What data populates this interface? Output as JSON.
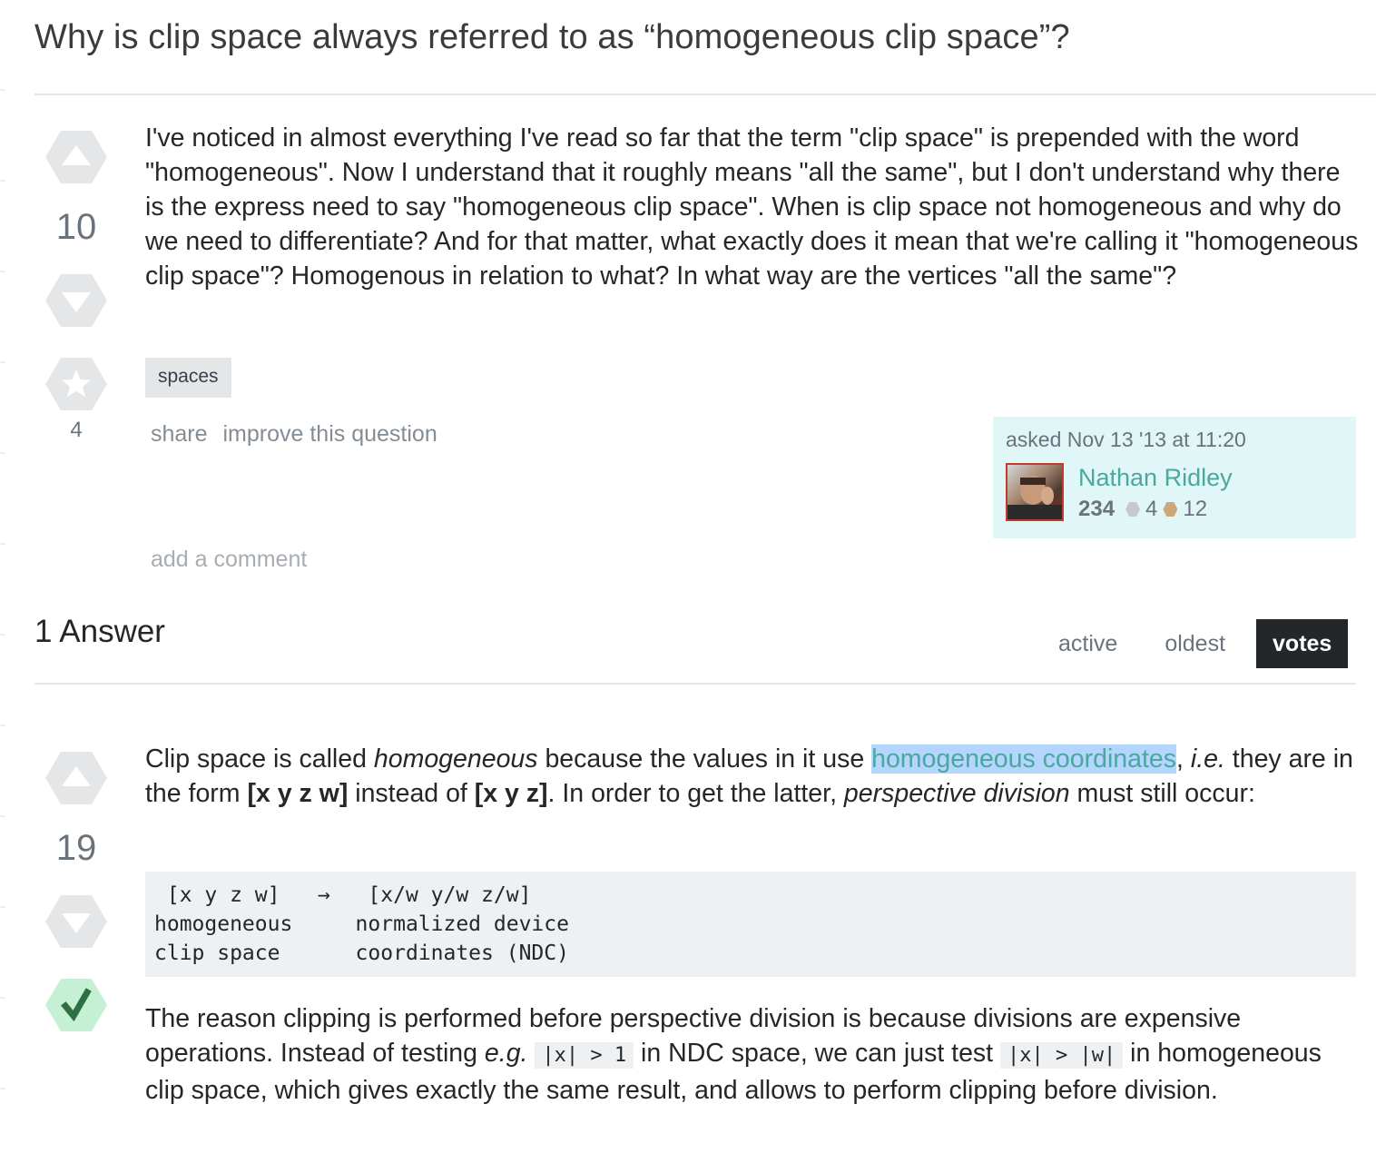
{
  "question": {
    "title": "Why is clip space always referred to as “homogeneous clip space”?",
    "votes": "10",
    "favorites": "4",
    "body": "I've noticed in almost everything I've read so far that the term \"clip space\" is prepended with the word \"homogeneous\". Now I understand that it roughly means \"all the same\", but I don't understand why there is the express need to say \"homogeneous clip space\". When is clip space not homogeneous and why do we need to differentiate? And for that matter, what exactly does it mean that we're calling it \"homogeneous clip space\"? Homogenous in relation to what? In what way are the vertices \"all the same\"?",
    "tag": "spaces",
    "menu": {
      "share": "share",
      "improve": "improve this question"
    },
    "add_comment": "add a comment",
    "asked": {
      "time": "asked Nov 13 '13 at 11:20",
      "user": "Nathan Ridley",
      "reputation": "234",
      "silver_badges": "4",
      "bronze_badges": "12"
    }
  },
  "answers_header": "1 Answer",
  "sort_tabs": {
    "active": "active",
    "oldest": "oldest",
    "votes": "votes"
  },
  "answer": {
    "votes": "19",
    "p1": {
      "t1": "Clip space is called ",
      "em1": "homogeneous",
      "t2": " because the values in it use ",
      "link": "homogeneous coordinates",
      "t3": ", ",
      "em2": "i.e.",
      "t4": " they are in the form ",
      "strong1": "[x y z w]",
      "t5": " instead of ",
      "strong2": "[x y z]",
      "t6": ". In order to get the latter, ",
      "em3": "perspective division",
      "t7": " must still occur:"
    },
    "code": " [x y z w]   →   [x/w y/w z/w]\nhomogeneous     normalized device\nclip space      coordinates (NDC)",
    "p2": {
      "t1": "The reason clipping is performed before perspective division is because divisions are expensive operations. Instead of testing ",
      "em1": "e.g.",
      "t2": " ",
      "code1": "|x| > 1",
      "t3": " in NDC space, we can just test ",
      "code2": "|x| > |w|",
      "t4": " in homogeneous clip space, which gives exactly the same result, and allows to perform clipping before division."
    }
  },
  "colors": {
    "accent": "#4aa89c",
    "accepted_bg": "#c6f0d4",
    "accepted_check": "#2f6f44",
    "user_card_bg": "#e1f6f7",
    "active_tab": "#242729"
  },
  "icons": [
    "vote-up-icon",
    "vote-down-icon",
    "favorite-star-icon",
    "accepted-check-icon",
    "silver-badge-icon",
    "bronze-badge-icon"
  ]
}
